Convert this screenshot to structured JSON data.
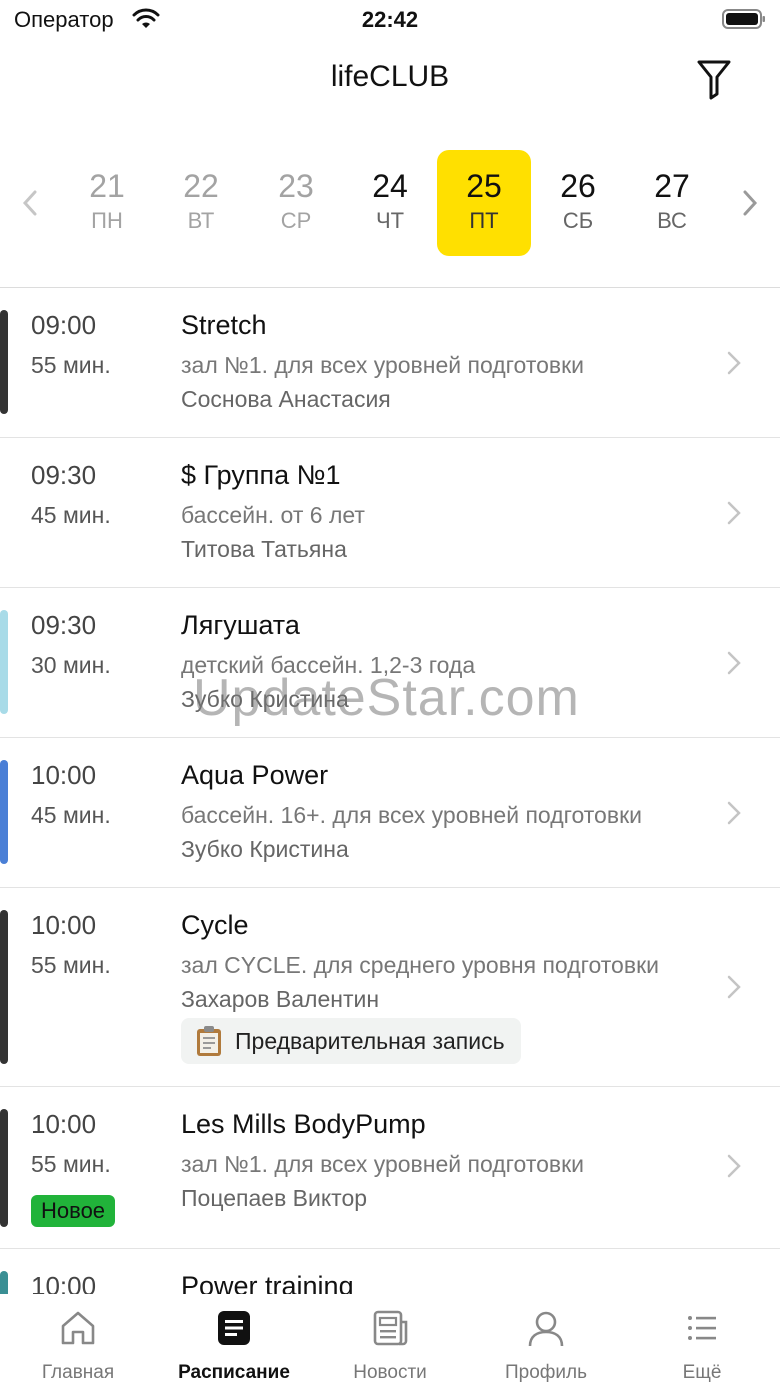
{
  "status_bar": {
    "carrier": "Оператор",
    "time": "22:42"
  },
  "header": {
    "title": "lifeCLUB"
  },
  "days": [
    {
      "num": "21",
      "dow": "ПН",
      "state": "past"
    },
    {
      "num": "22",
      "dow": "ВТ",
      "state": "past"
    },
    {
      "num": "23",
      "dow": "СР",
      "state": "past"
    },
    {
      "num": "24",
      "dow": "ЧТ",
      "state": "future"
    },
    {
      "num": "25",
      "dow": "ПТ",
      "state": "selected"
    },
    {
      "num": "26",
      "dow": "СБ",
      "state": "future"
    },
    {
      "num": "27",
      "dow": "ВС",
      "state": "future"
    }
  ],
  "classes": [
    {
      "time": "09:00",
      "duration": "55 мин.",
      "title": "Stretch",
      "place": "зал №1. для всех уровней подготовки",
      "trainer": "Соснова Анастасия",
      "color": "#333333"
    },
    {
      "time": "09:30",
      "duration": "45 мин.",
      "title": "$ Группа №1",
      "place": "бассейн. от 6 лет",
      "trainer": "Титова Татьяна",
      "color": ""
    },
    {
      "time": "09:30",
      "duration": "30 мин.",
      "title": "Лягушата",
      "place": "детский  бассейн. 1,2-3 года",
      "trainer": "Зубко Кристина",
      "color": "#a8dbe8"
    },
    {
      "time": "10:00",
      "duration": "45 мин.",
      "title": "Aqua Power",
      "place": "бассейн. 16+. для всех уровней подготовки",
      "trainer": "Зубко Кристина",
      "color": "#4a7fd6"
    },
    {
      "time": "10:00",
      "duration": "55 мин.",
      "title": "Cycle",
      "place": "зал CYCLE. для среднего уровня подготовки",
      "trainer": "Захаров Валентин",
      "color": "#333333",
      "tag": "Предварительная запись"
    },
    {
      "time": "10:00",
      "duration": "55 мин.",
      "title": "Les Mills BodyPump",
      "place": "зал №1. для всех уровней подготовки",
      "trainer": "Поцепаев Виктор",
      "color": "#333333",
      "badge": "Новое"
    },
    {
      "time": "10:00",
      "duration": "",
      "title": "Power training",
      "place": "",
      "trainer": "",
      "color": "#3a8f94"
    }
  ],
  "watermark": "UpdateStar.com",
  "tabs": [
    {
      "label": "Главная",
      "icon": "home-icon",
      "active": false
    },
    {
      "label": "Расписание",
      "icon": "schedule-icon",
      "active": true
    },
    {
      "label": "Новости",
      "icon": "news-icon",
      "active": false
    },
    {
      "label": "Профиль",
      "icon": "profile-icon",
      "active": false
    },
    {
      "label": "Ещё",
      "icon": "more-icon",
      "active": false
    }
  ],
  "colors": {
    "selected_day": "#ffe000",
    "badge_new": "#21b33a"
  }
}
